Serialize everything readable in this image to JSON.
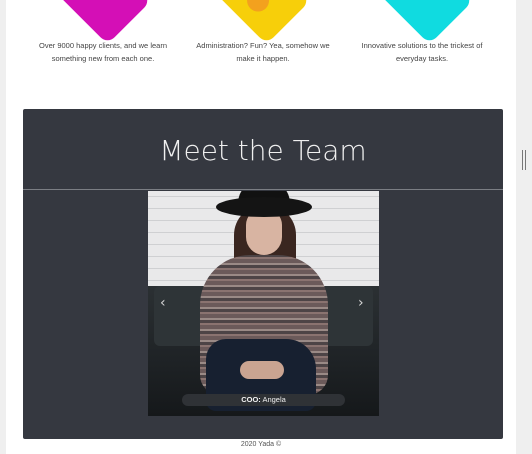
{
  "features": [
    {
      "text": "Over 9000 happy clients, and we learn something new from each one.",
      "color": "#d40fb6"
    },
    {
      "text": "Administration? Fun? Yea, somehow we make it happen.",
      "color": "#f7cf0a"
    },
    {
      "text": "Innovative solutions to the trickest of everyday tasks.",
      "color": "#10dbe0"
    }
  ],
  "team": {
    "title": "Meet the Team",
    "carousel": {
      "prev_icon": "chevron-left-icon",
      "next_icon": "chevron-right-icon",
      "caption_role": "COO:",
      "caption_name": "Angela"
    }
  },
  "footer": {
    "text": "2020 Yada ©"
  }
}
